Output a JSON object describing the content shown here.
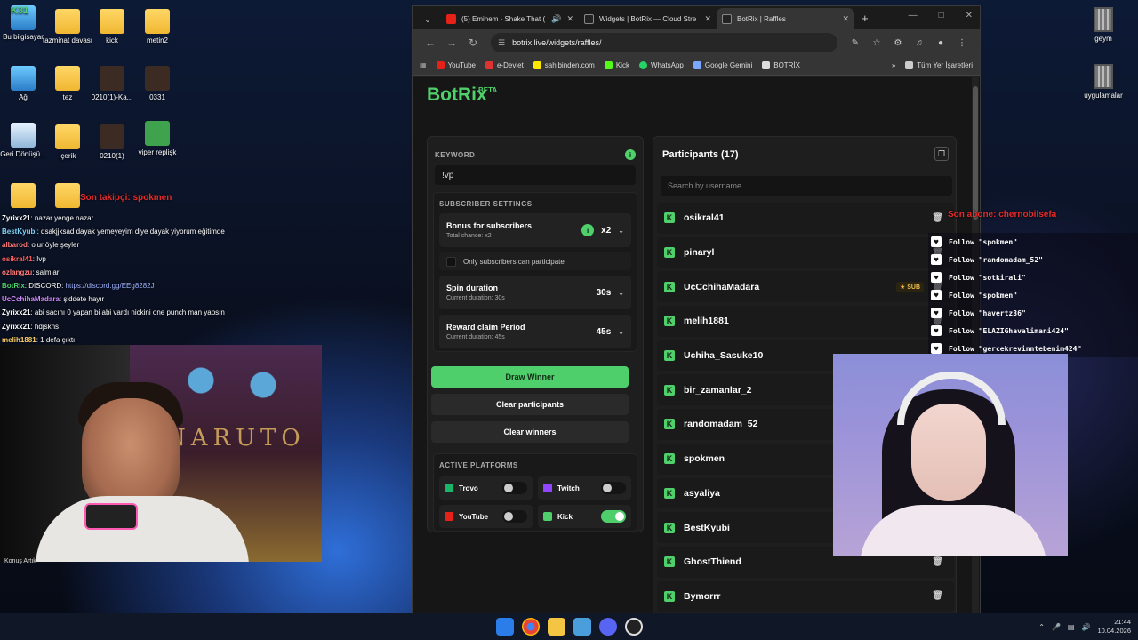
{
  "desktop": {
    "icons": [
      {
        "label": "Bu bilgisayar"
      },
      {
        "label": "tazminat davası"
      },
      {
        "label": "kick"
      },
      {
        "label": "metin2"
      },
      {
        "label": "Ağ"
      },
      {
        "label": "tez"
      },
      {
        "label": "0210(1)-Ka..."
      },
      {
        "label": "0331"
      },
      {
        "label": "Geri Dönüşü..."
      },
      {
        "label": "içerik"
      },
      {
        "label": "0210(1)"
      },
      {
        "label": "viper replişk"
      }
    ],
    "right_icons": [
      {
        "label": "geym"
      },
      {
        "label": "uygulamalar"
      }
    ],
    "kick_badge": "K31"
  },
  "overlays": {
    "last_subject": "Son takipçi: spokmen",
    "last_sub": "Son abone: chernobilsefa",
    "cam_label": "Konuş Artık",
    "follows": [
      "Follow \"spokmen\"",
      "Follow \"randomadam_52\"",
      "Follow \"sotkirali\"",
      "Follow \"spokmen\"",
      "Follow \"havertz36\"",
      "Follow \"ELAZIGhavalimani424\"",
      "Follow \"gercekrevinntebenim424\""
    ],
    "poster_text": "NARUTO"
  },
  "chat": [
    {
      "user": "Zyrixx21",
      "user_color": "#ffffff",
      "text": ": nazar yenge nazar"
    },
    {
      "user": "BestKyubi",
      "user_color": "#7ed6ff",
      "text": ": dsakjjksad dayak yemeyeyim diye dayak yiyorum eğitimde"
    },
    {
      "user": "albarod",
      "user_color": "#ff7a7a",
      "text": ": olur öyle şeyler"
    },
    {
      "user": "osikral41",
      "user_color": "#ff5f5f",
      "text": ": !vp"
    },
    {
      "user": "ozlangzu",
      "user_color": "#ff7a7a",
      "text": ": salmlar"
    },
    {
      "user": "BotRix",
      "user_color": "#4fd06a",
      "text": ": DISCORD: ",
      "link": "https://discord.gg/EEg8282J"
    },
    {
      "user": "UcCchihaMadara",
      "user_color": "#d28bff",
      "text": ": şiddete hayır"
    },
    {
      "user": "Zyrixx21",
      "user_color": "#ffffff",
      "text": ": abi sacını 0 yapan bi abi vardı nickini one punch man yapsın"
    },
    {
      "user": "Zyrixx21",
      "user_color": "#ffffff",
      "text": ": hdjskns"
    },
    {
      "user": "melih1881",
      "user_color": "#ffd36a",
      "text": ": 1 defa çıktı"
    }
  ],
  "browser": {
    "tabs": [
      {
        "title": "(5) Eminem - Shake That (",
        "active": false
      },
      {
        "title": "Widgets | BotRix — Cloud Stre",
        "active": false
      },
      {
        "title": "BotRix | Raffles",
        "active": true
      }
    ],
    "url": "botrix.live/widgets/raffles/",
    "bookmarks": [
      "YouTube",
      "e-Devlet",
      "sahibinden.com",
      "Kick",
      "WhatsApp",
      "Google Gemini",
      "BOTRİX"
    ],
    "all_bookmarks": "Tüm Yer İşaretleri"
  },
  "raffle": {
    "brand": "BotRix",
    "brand_badge": "BETA",
    "keyword_label": "KEYWORD",
    "keyword_value": "!vp",
    "subscriber_settings_label": "SUBSCRIBER SETTINGS",
    "bonus_title": "Bonus for subscribers",
    "bonus_sub": "Total chance: x2",
    "bonus_value": "x2",
    "only_subs": "Only subscribers can participate",
    "spin_title": "Spin duration",
    "spin_sub": "Current duration: 30s",
    "spin_value": "30s",
    "claim_title": "Reward claim Period",
    "claim_sub": "Current duration: 45s",
    "claim_value": "45s",
    "draw_btn": "Draw Winner",
    "clear_participants_btn": "Clear participants",
    "clear_winners_btn": "Clear winners",
    "active_platforms_label": "ACTIVE PLATFORMS",
    "platforms": [
      {
        "name": "Trovo",
        "enabled": false
      },
      {
        "name": "Twitch",
        "enabled": false
      },
      {
        "name": "YouTube",
        "enabled": false
      },
      {
        "name": "Kick",
        "enabled": true
      }
    ],
    "participants_title": "Participants (17)",
    "search_placeholder": "Search by username...",
    "participants": [
      {
        "name": "osikral41"
      },
      {
        "name": "pinaryl"
      },
      {
        "name": "UcCchihaMadara",
        "badge": "SUB"
      },
      {
        "name": "melih1881"
      },
      {
        "name": "Uchiha_Sasuke10"
      },
      {
        "name": "bir_zamanlar_2"
      },
      {
        "name": "randomadam_52"
      },
      {
        "name": "spokmen"
      },
      {
        "name": "asyaliya"
      },
      {
        "name": "BestKyubi"
      },
      {
        "name": "GhostThiend"
      },
      {
        "name": "Bymorrr"
      }
    ]
  },
  "taskbar": {
    "time": "21:44",
    "date": "10.04.2026"
  },
  "colors": {
    "accent": "#4fcf6b",
    "kick": "#4fd06a"
  }
}
